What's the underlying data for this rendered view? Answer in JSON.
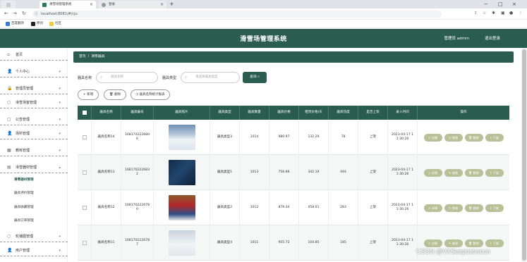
{
  "browser": {
    "tabs": [
      {
        "label": "滑雪场管理系统",
        "active": true
      },
      {
        "label": "登录",
        "active": false
      }
    ],
    "new_tab": "+",
    "url": "localhost:8081/#/cju",
    "bookmarks": [
      "百度翻译",
      "原创",
      "社区"
    ]
  },
  "header": {
    "title": "滑雪场管理系统",
    "user": "管理员 admin",
    "logout": "退出登录"
  },
  "sidebar": {
    "items": [
      {
        "label": "首页",
        "icon": "home-icon"
      },
      {
        "label": "个人中心",
        "icon": "user-icon"
      },
      {
        "label": "管理员管理",
        "icon": "lock-icon"
      },
      {
        "label": "滑雪场客管理",
        "icon": "circle-icon"
      },
      {
        "label": "公告管理",
        "icon": "doc-icon"
      },
      {
        "label": "场所管理",
        "icon": "user-icon"
      },
      {
        "label": "教练管理",
        "icon": "grid-icon"
      },
      {
        "label": "滑雪器材管理",
        "icon": "folder-icon"
      }
    ],
    "sub_items": [
      "滑雪器材管理",
      "器具评价管理",
      "器具收藏管理",
      "器具订单管理"
    ],
    "tail_items": [
      {
        "label": "轮播图管理",
        "icon": "circle-icon"
      },
      {
        "label": "用户管理",
        "icon": "user-icon"
      }
    ]
  },
  "breadcrumb": {
    "home": "首页",
    "separator": "/",
    "current": "滑雪器具"
  },
  "search": {
    "name_label": "器具名称",
    "name_placeholder": "器具名称",
    "type_label": "器具类型",
    "type_placeholder": "请选择器具类型",
    "search_button": "查询"
  },
  "actions": {
    "add": "新增",
    "delete": "删除",
    "report": "器具名称统计报表"
  },
  "table": {
    "columns": [
      "器具名称",
      "器具编号",
      "器具照片",
      "器具类型",
      "器具数量",
      "器具价格",
      "租赁价格/天",
      "器具热度",
      "是否上架",
      "录入时间",
      "操作"
    ],
    "rows": [
      {
        "name": "器具名称14",
        "code": "1681702226806",
        "type": "器具类型3",
        "qty": "1014",
        "price": "980.97",
        "rent": "132.29",
        "heat": "78",
        "shelf": "上架",
        "time": "2023-04-17 11:30:26",
        "photo": "photo-skier-snow"
      },
      {
        "name": "器具名称13",
        "code": "1681702226832",
        "type": "器具类型1",
        "qty": "1013",
        "price": "756.86",
        "rent": "342.19",
        "heat": "444",
        "shelf": "上架",
        "time": "2023-04-17 11:30:26",
        "photo": "photo-ski-gear"
      },
      {
        "name": "器具名称12",
        "code": "1681702226780",
        "type": "器具类型2",
        "qty": "1012",
        "price": "879.34",
        "rent": "458.01",
        "heat": "283",
        "shelf": "上架",
        "time": "2023-04-17 11:30:26",
        "photo": "photo-ski-shop"
      },
      {
        "name": "器具名称11",
        "code": "1681702226787",
        "type": "器具类型4",
        "qty": "1011",
        "price": "955.72",
        "rent": "104.85",
        "heat": "185",
        "shelf": "上架",
        "time": "2023-04-17 11:30:26",
        "photo": "photo-ski-kids"
      }
    ],
    "op_buttons": [
      "详情",
      "修改",
      "删除",
      "下架"
    ]
  },
  "watermark": "CSDN @VXSeapostmoon"
}
